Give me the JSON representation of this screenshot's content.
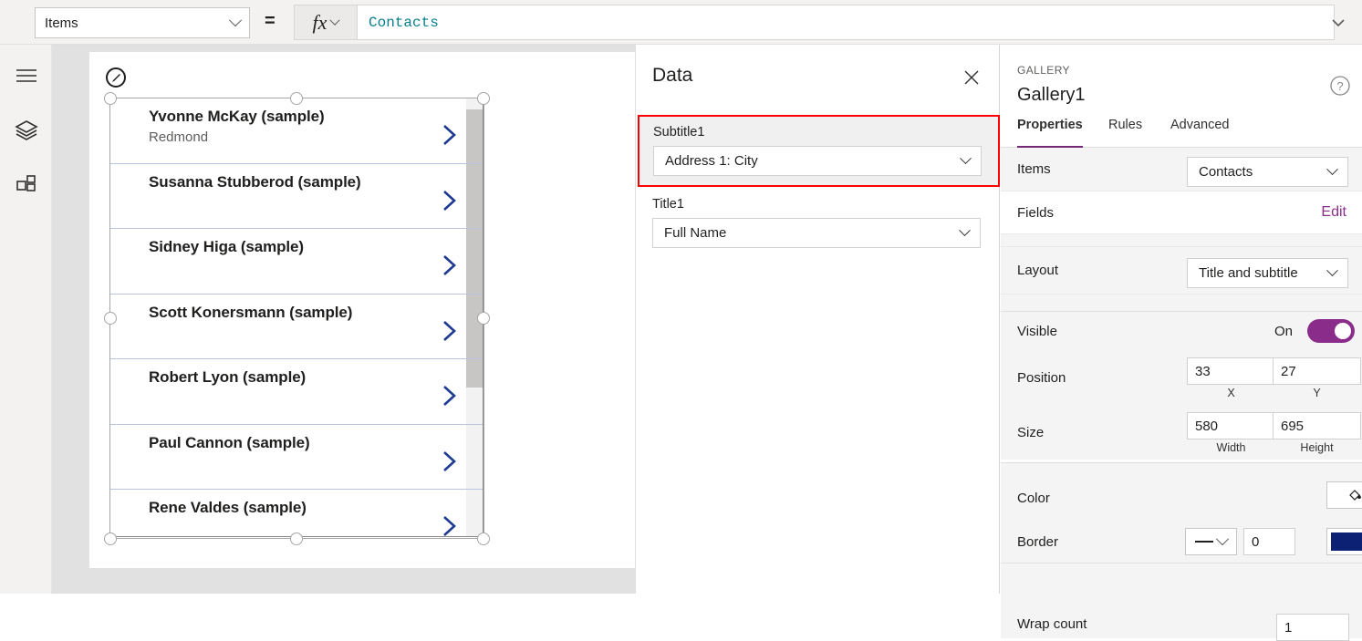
{
  "formula_bar": {
    "property": "Items",
    "equals": "=",
    "fx": "fx",
    "expression": "Contacts"
  },
  "left_rail": {
    "items": [
      {
        "icon": "hamburger-icon",
        "name": "menu"
      },
      {
        "icon": "layers-icon",
        "name": "tree-view"
      },
      {
        "icon": "insert-icon",
        "name": "insert"
      }
    ]
  },
  "canvas": {
    "gallery": {
      "items": [
        {
          "title": "Yvonne McKay (sample)",
          "subtitle": "Redmond"
        },
        {
          "title": "Susanna Stubberod (sample)",
          "subtitle": ""
        },
        {
          "title": "Sidney Higa (sample)",
          "subtitle": ""
        },
        {
          "title": "Scott Konersmann (sample)",
          "subtitle": ""
        },
        {
          "title": "Robert Lyon (sample)",
          "subtitle": ""
        },
        {
          "title": "Paul Cannon (sample)",
          "subtitle": ""
        },
        {
          "title": "Rene Valdes (sample)",
          "subtitle": ""
        }
      ],
      "chevron_color": "#1f3a93"
    }
  },
  "data_panel": {
    "title": "Data",
    "close": "✕",
    "fields": [
      {
        "label": "Subtitle1",
        "value": "Address 1: City",
        "highlighted": true
      },
      {
        "label": "Title1",
        "value": "Full Name",
        "highlighted": false
      }
    ],
    "highlight_color": "#ff0000"
  },
  "right_panel": {
    "kind": "GALLERY",
    "name": "Gallery1",
    "help": "?",
    "tabs": [
      {
        "label": "Properties",
        "active": true
      },
      {
        "label": "Rules",
        "active": false
      },
      {
        "label": "Advanced",
        "active": false
      }
    ],
    "accent_color": "#742774",
    "rows": {
      "items": {
        "label": "Items",
        "value": "Contacts"
      },
      "fields": {
        "label": "Fields",
        "action": "Edit"
      },
      "layout": {
        "label": "Layout",
        "value": "Title and subtitle"
      },
      "visible": {
        "label": "Visible",
        "state": "On"
      },
      "position": {
        "label": "Position",
        "x": "33",
        "y": "27",
        "x_sublabel": "X",
        "y_sublabel": "Y"
      },
      "size": {
        "label": "Size",
        "width": "580",
        "height": "695",
        "width_sublabel": "Width",
        "height_sublabel": "Height"
      },
      "color": {
        "label": "Color",
        "icon": "paint-bucket-icon"
      },
      "border": {
        "label": "Border",
        "style": "solid",
        "width": "0",
        "color": "#0c2074"
      },
      "wrap_count": {
        "label": "Wrap count",
        "value": "1"
      }
    }
  }
}
